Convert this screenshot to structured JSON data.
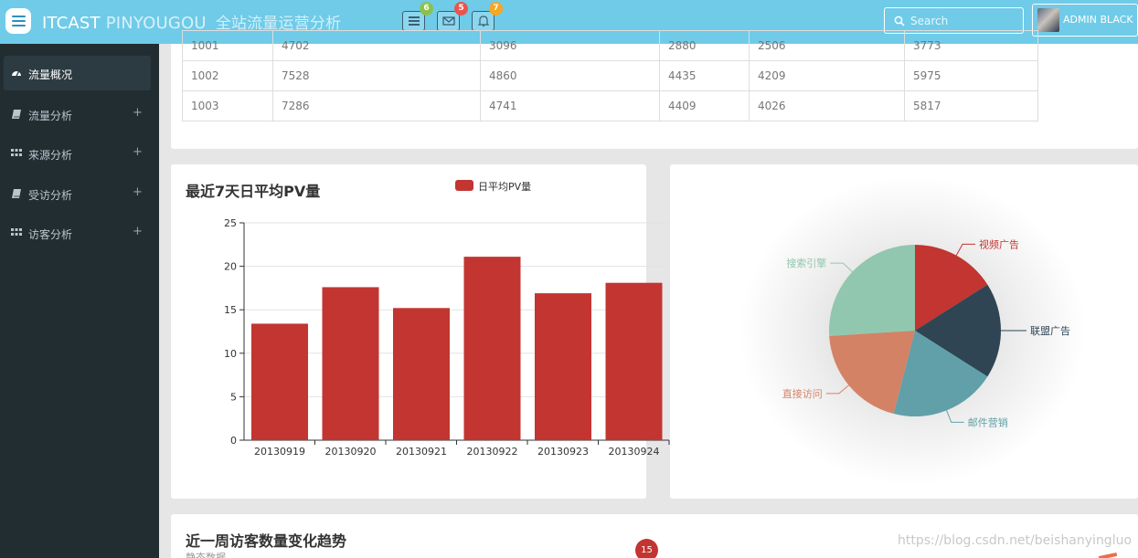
{
  "header": {
    "brand_main": "ITCAST",
    "brand_rest": "PINYOUGOU",
    "brand_cn": "全站流量运营分析",
    "badges": [
      {
        "icon": "tasks-icon",
        "count": "6",
        "color": "#8cc152"
      },
      {
        "icon": "envelope-icon",
        "count": "5",
        "color": "#e8554e"
      },
      {
        "icon": "bell-icon",
        "count": "7",
        "color": "#f6a623"
      }
    ],
    "search_placeholder": "Search",
    "user_name": "ADMIN BLACK"
  },
  "sidebar": {
    "items": [
      {
        "label": "流量概况",
        "icon": "dashboard-icon",
        "active": true
      },
      {
        "label": "流量分析",
        "icon": "book-icon"
      },
      {
        "label": "来源分析",
        "icon": "grid-icon"
      },
      {
        "label": "受访分析",
        "icon": "book-icon"
      },
      {
        "label": "访客分析",
        "icon": "grid-icon"
      }
    ],
    "expand_symbol": "+"
  },
  "table": {
    "rows": [
      [
        "1001",
        "4702",
        "3096",
        "2880",
        "2506",
        "3773"
      ],
      [
        "1002",
        "7528",
        "4860",
        "4435",
        "4209",
        "5975"
      ],
      [
        "1003",
        "7286",
        "4741",
        "4409",
        "4026",
        "5817"
      ]
    ]
  },
  "bar_panel": {
    "title": "最近7天日平均PV量"
  },
  "trend_panel": {
    "title": "近一周访客数量变化趋势",
    "subtitle": "静态数据",
    "badge": "15"
  },
  "watermark": "https://blog.csdn.net/beishanyingluo",
  "chart_data": [
    {
      "type": "bar",
      "categories": [
        "20130919",
        "20130920",
        "20130921",
        "20130922",
        "20130923",
        "20130924"
      ],
      "series": [
        {
          "name": "日平均PV量",
          "values": [
            13.4,
            17.6,
            15.2,
            21.1,
            16.9,
            18.1
          ],
          "color": "#c23531"
        }
      ],
      "legend": "top",
      "ylim": [
        0,
        25
      ],
      "yticks": [
        "0",
        "5",
        "10",
        "15",
        "20",
        "25"
      ],
      "grid": true
    },
    {
      "type": "pie",
      "slices": [
        {
          "label": "视频广告",
          "value": 16,
          "color": "#c23531"
        },
        {
          "label": "联盟广告",
          "value": 18,
          "color": "#2f4554"
        },
        {
          "label": "邮件营销",
          "value": 20,
          "color": "#61a0a8"
        },
        {
          "label": "直接访问",
          "value": 20,
          "color": "#d48265"
        },
        {
          "label": "搜索引擎",
          "value": 26,
          "color": "#91c7ae"
        }
      ]
    }
  ]
}
